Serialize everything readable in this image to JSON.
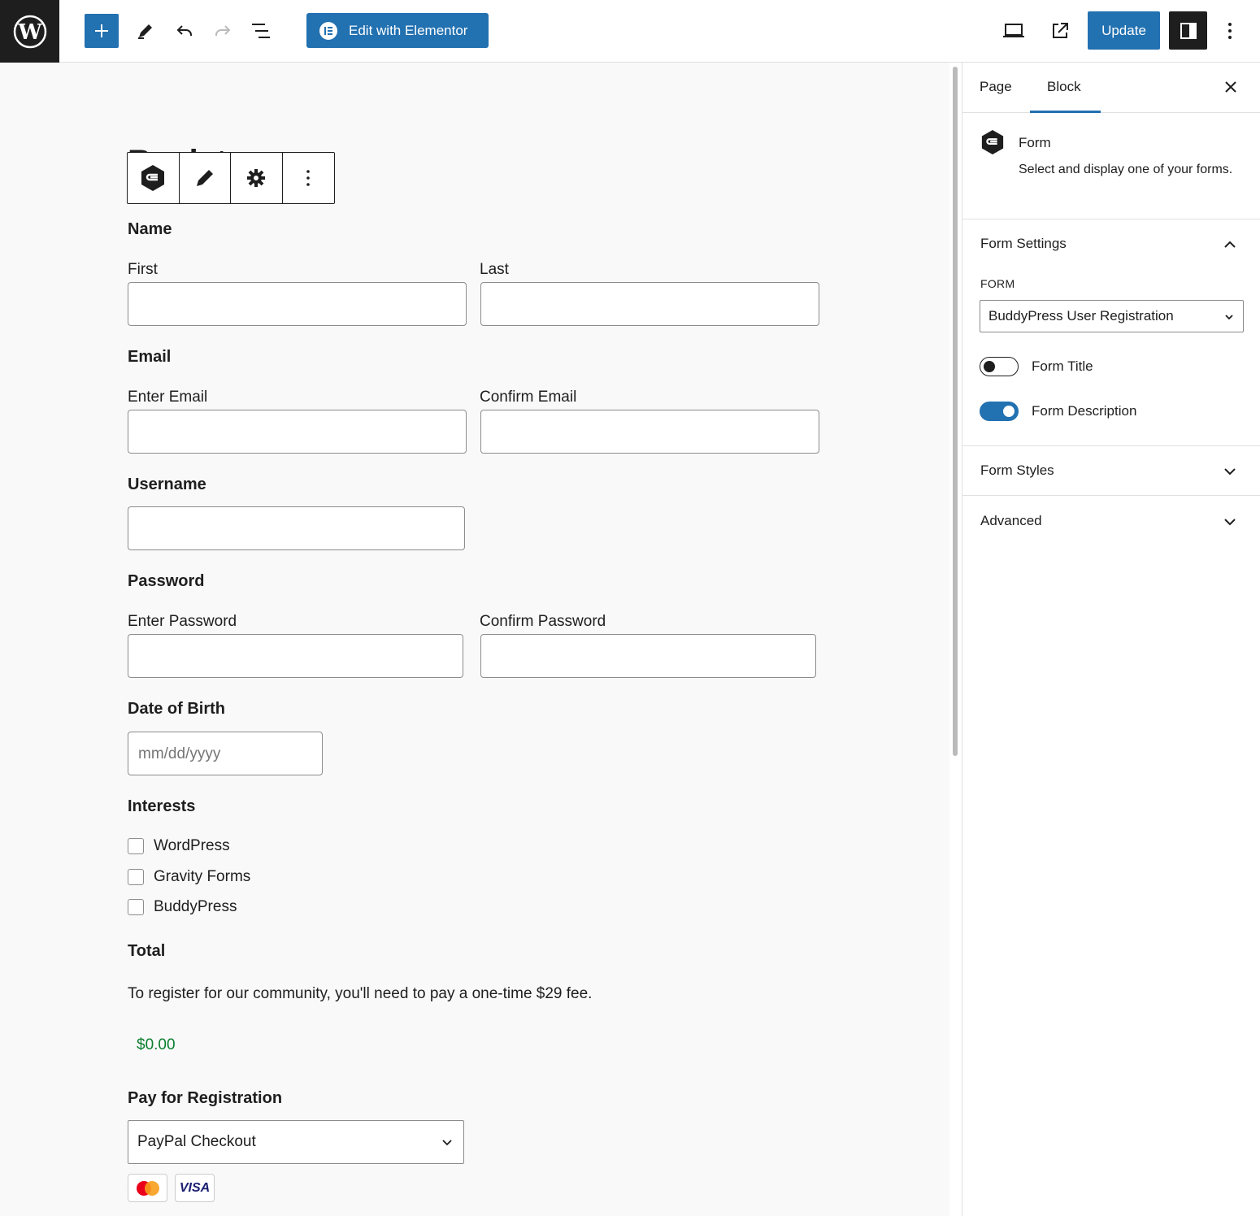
{
  "toolbar": {
    "elementor_label": "Edit with Elementor",
    "update_label": "Update"
  },
  "page": {
    "title": "Register"
  },
  "form": {
    "name": {
      "label": "Name",
      "first": "First",
      "last": "Last"
    },
    "email": {
      "label": "Email",
      "enter": "Enter Email",
      "confirm": "Confirm Email"
    },
    "username": {
      "label": "Username"
    },
    "password": {
      "label": "Password",
      "enter": "Enter Password",
      "confirm": "Confirm Password"
    },
    "dob": {
      "label": "Date of Birth",
      "placeholder": "mm/dd/yyyy"
    },
    "interests": {
      "label": "Interests",
      "options": [
        "WordPress",
        "Gravity Forms",
        "BuddyPress"
      ]
    },
    "total": {
      "label": "Total",
      "note": "To register for our community, you'll need to pay a one-time $29 fee.",
      "value": "$0.00"
    },
    "payment": {
      "label": "Pay for Registration",
      "selected": "PayPal Checkout",
      "cards": [
        "mastercard",
        "VISA"
      ]
    }
  },
  "sidebar": {
    "tabs": [
      "Page",
      "Block"
    ],
    "active_tab": "Block",
    "block": {
      "title": "Form",
      "description": "Select and display one of your forms."
    },
    "form_settings": {
      "label": "Form Settings",
      "form_label": "FORM",
      "form_selected": "BuddyPress User Registration",
      "toggles": [
        {
          "label": "Form Title",
          "on": false
        },
        {
          "label": "Form Description",
          "on": true
        }
      ]
    },
    "form_styles_label": "Form Styles",
    "advanced_label": "Advanced"
  },
  "colors": {
    "accent": "#2271b1",
    "dark": "#1e1e1e",
    "total_green": "#0a7f2e"
  }
}
